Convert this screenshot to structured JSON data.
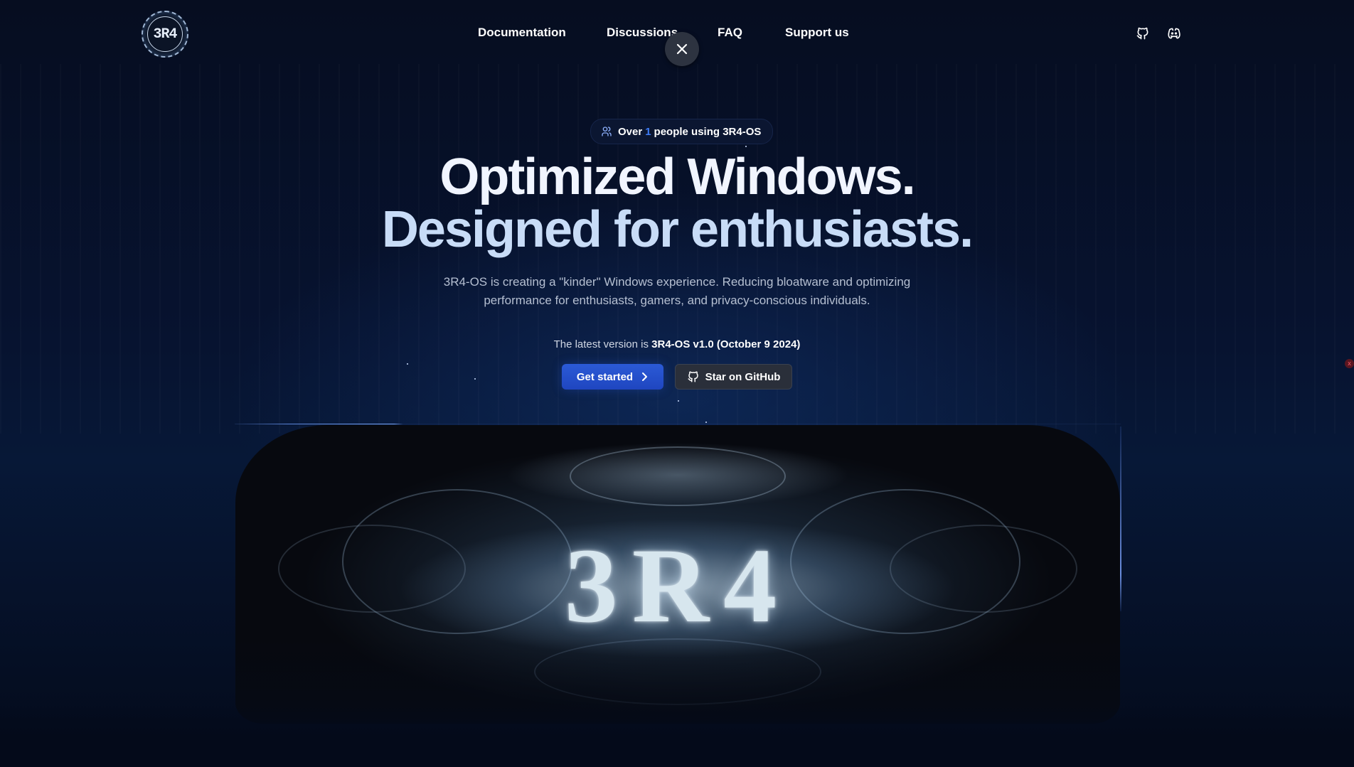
{
  "nav": {
    "logo_text": "3R4",
    "links": [
      "Documentation",
      "Discussions",
      "FAQ",
      "Support us"
    ],
    "icons": [
      "github-icon",
      "discord-icon"
    ],
    "close_icon": "close-icon"
  },
  "hero": {
    "pill_prefix": "Over",
    "pill_count": "1",
    "pill_suffix": "people using 3R4-OS",
    "headline_line1": "Optimized Windows.",
    "headline_line2": "Designed for enthusiasts.",
    "description_line1": "3R4-OS is creating a \"kinder\" Windows experience. Reducing bloatware and optimizing",
    "description_line2": "performance for enthusiasts, gamers, and privacy-conscious individuals.",
    "version_prefix": "The latest version is",
    "version_value": "3R4-OS v1.0 (October 9 2024)",
    "primary_button": "Get started",
    "secondary_button": "Star on GitHub"
  },
  "banner": {
    "title": "3R4"
  },
  "misc": {
    "corner_close": "x"
  },
  "colors": {
    "background": "#050b1c",
    "accent": "#2b5ad6",
    "highlight": "#3e7cf6",
    "headline_secondary": "#c8dcf7"
  }
}
